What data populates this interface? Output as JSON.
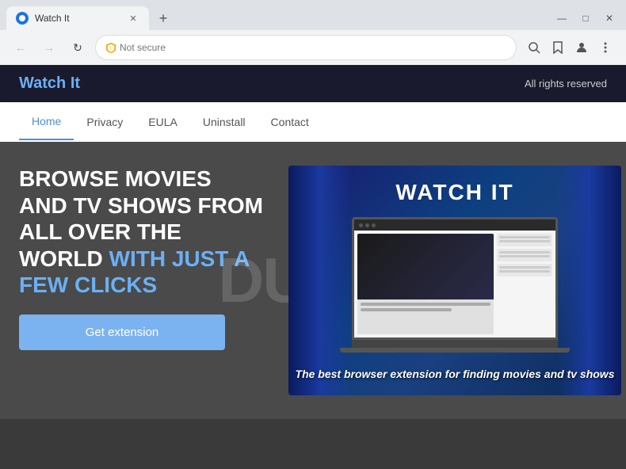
{
  "browser": {
    "tab_title": "Watch It",
    "tab_favicon_color": "#1a73e8",
    "address": "Not secure",
    "window_controls": {
      "minimize": "—",
      "maximize": "□",
      "close": "✕"
    },
    "toolbar_icons": [
      "search",
      "star",
      "profile",
      "menu"
    ]
  },
  "site": {
    "logo": "Watch It",
    "header_right": "All rights reserved",
    "nav": {
      "items": [
        {
          "label": "Home",
          "active": true
        },
        {
          "label": "Privacy",
          "active": false
        },
        {
          "label": "EULA",
          "active": false
        },
        {
          "label": "Uninstall",
          "active": false
        },
        {
          "label": "Contact",
          "active": false
        }
      ]
    },
    "hero": {
      "headline_part1": "BROWSE MOVIES AND TV SHOWS FROM ALL OVER THE WORLD ",
      "headline_highlight": "WITH JUST A FEW CLICKS",
      "cta_button": "Get extension",
      "image_title": "WATCH IT",
      "image_caption": "The best browser extension for finding movies and tv shows"
    }
  },
  "watermark": "DUSIK"
}
